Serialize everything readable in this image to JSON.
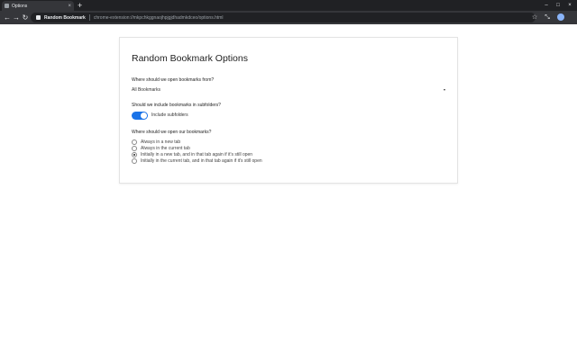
{
  "tab": {
    "title": "Options",
    "close_glyph": "×",
    "new_tab_glyph": "+"
  },
  "window_controls": {
    "minimize": "–",
    "maximize": "□",
    "close": "×"
  },
  "toolbar": {
    "back": "←",
    "forward": "→",
    "reload": "↻",
    "origin": "Random Bookmark",
    "path": "chrome-extension://mkpchkggnaojhpjgjdhadmkdceo/options.html",
    "star": "☆",
    "ext": "⤡"
  },
  "page": {
    "title": "Random Bookmark Options",
    "q1": "Where should we open bookmarks from?",
    "select_value": "All Bookmarks",
    "caret": "▾",
    "q2": "Should we include bookmarks in subfolders?",
    "toggle_label": "Include subfolders",
    "toggle_on": true,
    "q3": "Where should we open our bookmarks?",
    "options": [
      "Always in a new tab",
      "Always in the current tab",
      "Initially in a new tab, and in that tab again if it's still open",
      "Initially in the current tab, and in that tab again if it's still open"
    ],
    "selected_option_index": 2
  },
  "colors": {
    "accent": "#1a73e8",
    "tabstrip": "#202124",
    "toolbar": "#35363a"
  }
}
